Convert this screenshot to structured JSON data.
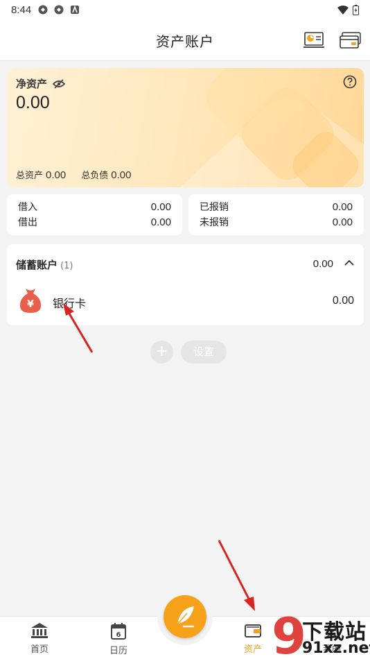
{
  "status_bar": {
    "time": "8:44"
  },
  "header": {
    "title": "资产账户"
  },
  "net_assets": {
    "label": "净资产",
    "value": "0.00",
    "total_assets_label": "总资产",
    "total_assets_value": "0.00",
    "total_liabilities_label": "总负债",
    "total_liabilities_value": "0.00"
  },
  "loans": {
    "lend_label": "借入",
    "lend_value": "0.00",
    "borrow_label": "借出",
    "borrow_value": "0.00"
  },
  "reimburse": {
    "done_label": "已报销",
    "done_value": "0.00",
    "pending_label": "未报销",
    "pending_value": "0.00"
  },
  "savings": {
    "title": "储蓄账户",
    "count": "(1)",
    "total": "0.00",
    "accounts": [
      {
        "name": "银行卡",
        "amount": "0.00"
      }
    ]
  },
  "actions": {
    "settings_label": "设置",
    "add_label": "+"
  },
  "bottom_nav": {
    "home": "首页",
    "calendar": "日历",
    "calendar_day": "6",
    "assets": "资产",
    "mine": "我的"
  },
  "watermark": {
    "line1": "下载站",
    "line2": "91xz.net"
  },
  "colors": {
    "accent": "#f5a21a",
    "card_bg": "#ffe6b8",
    "page_bg": "#f3f3f3"
  }
}
